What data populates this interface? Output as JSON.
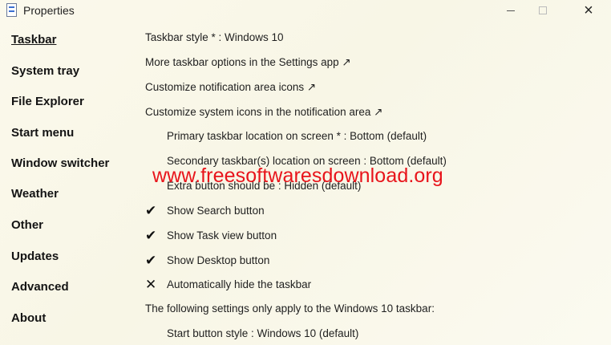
{
  "window": {
    "title": "Properties",
    "icon": "properties-app-icon",
    "controls": {
      "minimize": "minimize-icon",
      "maximize": "maximize-icon",
      "close": "×"
    }
  },
  "sidebar": {
    "items": [
      {
        "label": "Taskbar",
        "active": true
      },
      {
        "label": "System tray"
      },
      {
        "label": "File Explorer"
      },
      {
        "label": "Start menu"
      },
      {
        "label": "Window switcher"
      },
      {
        "label": "Weather"
      },
      {
        "label": "Other"
      },
      {
        "label": "Updates"
      },
      {
        "label": "Advanced"
      },
      {
        "label": "About"
      }
    ]
  },
  "settings": {
    "taskbar_style": "Taskbar style * : Windows 10",
    "more_options": "More taskbar options in the Settings app ↗",
    "notification_icons": "Customize notification area icons ↗",
    "system_icons": "Customize system icons in the notification area ↗",
    "primary_location": "Primary taskbar location on screen * : Bottom (default)",
    "secondary_location": "Secondary taskbar(s) location on screen : Bottom (default)",
    "extra_button": "Extra button should be : Hidden (default)",
    "show_search": {
      "label": "Show Search button",
      "mark": "✔",
      "checked": true
    },
    "show_task_view": {
      "label": "Show Task view button",
      "mark": "✔",
      "checked": true
    },
    "show_desktop": {
      "label": "Show Desktop button",
      "mark": "✔",
      "checked": true
    },
    "auto_hide": {
      "label": "Automatically hide the taskbar",
      "mark": "✕",
      "checked": false
    },
    "win10_note": "The following settings only apply to the Windows 10 taskbar:",
    "start_button_style": "Start button style : Windows 10 (default)"
  },
  "watermark": "www.freesoftwaresdownload.org",
  "colors": {
    "watermark": "#e8141b",
    "background": "#fbf9ec"
  }
}
